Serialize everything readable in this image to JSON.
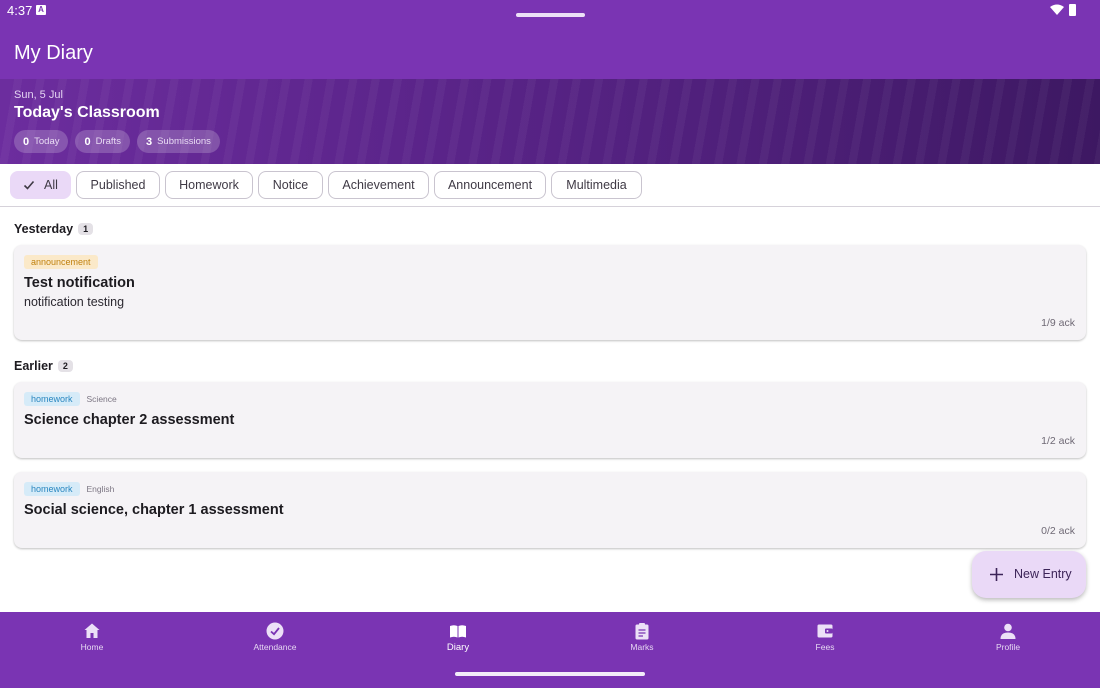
{
  "status_bar": {
    "time": "4:37"
  },
  "app_bar": {
    "title": "My Diary"
  },
  "hero": {
    "date": "Sun, 5 Jul",
    "title": "Today's Classroom",
    "stats": [
      {
        "value": "0",
        "label": "Today"
      },
      {
        "value": "0",
        "label": "Drafts"
      },
      {
        "value": "3",
        "label": "Submissions"
      }
    ]
  },
  "filters": {
    "selected": "All",
    "items": [
      "All",
      "Published",
      "Homework",
      "Notice",
      "Achievement",
      "Announcement",
      "Multimedia"
    ]
  },
  "sections": [
    {
      "title": "Yesterday",
      "count": "1",
      "entries": [
        {
          "tag": "announcement",
          "subject": "",
          "title": "Test notification",
          "body": "notification testing",
          "ack": "1/9 ack"
        }
      ]
    },
    {
      "title": "Earlier",
      "count": "2",
      "entries": [
        {
          "tag": "homework",
          "subject": "Science",
          "title": "Science chapter 2 assessment",
          "body": "",
          "ack": "1/2 ack"
        },
        {
          "tag": "homework",
          "subject": "English",
          "title": "Social science, chapter 1 assessment",
          "body": "",
          "ack": "0/2 ack"
        }
      ]
    }
  ],
  "fab": {
    "label": "New Entry",
    "icon": "plus-icon"
  },
  "bottom_nav": {
    "active": "Diary",
    "items": [
      {
        "label": "Home",
        "icon": "home-icon"
      },
      {
        "label": "Attendance",
        "icon": "check-circle-icon"
      },
      {
        "label": "Diary",
        "icon": "book-icon"
      },
      {
        "label": "Marks",
        "icon": "clipboard-icon"
      },
      {
        "label": "Fees",
        "icon": "wallet-icon"
      },
      {
        "label": "Profile",
        "icon": "person-icon"
      }
    ]
  },
  "colors": {
    "primary": "#7a34b3",
    "chip_selected": "#ead9f7",
    "announcement": "#c0800e",
    "homework": "#2a87c0"
  }
}
